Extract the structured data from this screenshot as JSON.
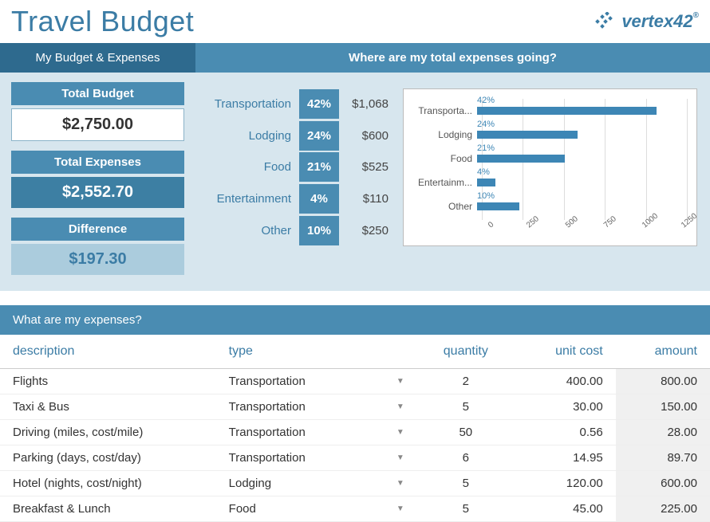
{
  "title": "Travel Budget",
  "logo_text": "vertex42",
  "budget_panel": {
    "header": "My Budget & Expenses",
    "total_budget_label": "Total Budget",
    "total_budget_value": "$2,750.00",
    "total_expenses_label": "Total Expenses",
    "total_expenses_value": "$2,552.70",
    "difference_label": "Difference",
    "difference_value": "$197.30"
  },
  "expenses_panel": {
    "header": "Where are my total expenses going?",
    "categories": [
      {
        "name": "Transportation",
        "pct": "42%",
        "amount": "$1,068"
      },
      {
        "name": "Lodging",
        "pct": "24%",
        "amount": "$600"
      },
      {
        "name": "Food",
        "pct": "21%",
        "amount": "$525"
      },
      {
        "name": "Entertainment",
        "pct": "4%",
        "amount": "$110"
      },
      {
        "name": "Other",
        "pct": "10%",
        "amount": "$250"
      }
    ]
  },
  "chart_data": {
    "type": "bar",
    "orientation": "horizontal",
    "categories": [
      "Transporta...",
      "Lodging",
      "Food",
      "Entertainm...",
      "Other"
    ],
    "values": [
      1068,
      600,
      525,
      110,
      250
    ],
    "labels": [
      "42%",
      "24%",
      "21%",
      "4%",
      "10%"
    ],
    "xlim": [
      0,
      1250
    ],
    "ticks": [
      0,
      250,
      500,
      750,
      1000,
      1250
    ]
  },
  "expense_table": {
    "header": "What are my expenses?",
    "columns": {
      "description": "description",
      "type": "type",
      "quantity": "quantity",
      "unit_cost": "unit cost",
      "amount": "amount"
    },
    "rows": [
      {
        "description": "Flights",
        "type": "Transportation",
        "quantity": "2",
        "unit_cost": "400.00",
        "amount": "800.00"
      },
      {
        "description": "Taxi & Bus",
        "type": "Transportation",
        "quantity": "5",
        "unit_cost": "30.00",
        "amount": "150.00"
      },
      {
        "description": "Driving (miles, cost/mile)",
        "type": "Transportation",
        "quantity": "50",
        "unit_cost": "0.56",
        "amount": "28.00"
      },
      {
        "description": "Parking (days, cost/day)",
        "type": "Transportation",
        "quantity": "6",
        "unit_cost": "14.95",
        "amount": "89.70"
      },
      {
        "description": "Hotel (nights, cost/night)",
        "type": "Lodging",
        "quantity": "5",
        "unit_cost": "120.00",
        "amount": "600.00"
      },
      {
        "description": "Breakfast & Lunch",
        "type": "Food",
        "quantity": "5",
        "unit_cost": "45.00",
        "amount": "225.00"
      }
    ]
  }
}
